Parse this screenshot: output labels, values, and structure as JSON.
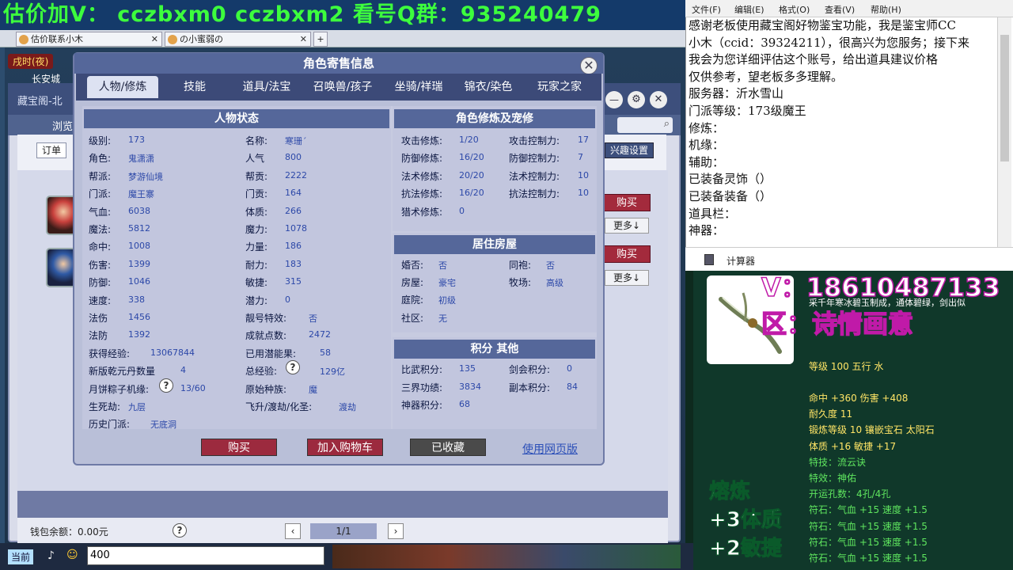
{
  "banner": {
    "text": "估价加V： cczbxm0 cczbxm2 看号Q群：935240479"
  },
  "browser_tabs": [
    {
      "label": "估价联系小木"
    },
    {
      "label": "の小蜜弱の"
    }
  ],
  "game": {
    "time": "戌时(夜)",
    "location": "长安城",
    "behind_title": "藏宝阁-北",
    "behind_nav": "浏览",
    "order_btn": "订单",
    "interest_btn": "兴趣设置",
    "buy_label": "购买",
    "more_label": "更多↓",
    "wallet": "钱包余额：0.00元",
    "page": "1/1",
    "chat_channel": "当前",
    "chat_input": "400"
  },
  "dialog": {
    "title": "角色寄售信息",
    "tabs": [
      "人物/修炼",
      "技能",
      "道具/法宝",
      "召唤兽/孩子",
      "坐骑/祥瑞",
      "锦衣/染色",
      "玩家之家"
    ],
    "status": {
      "header": "人物状态",
      "left": [
        {
          "k": "级别:",
          "v": "173"
        },
        {
          "k": "角色:",
          "v": "鬼潇潇"
        },
        {
          "k": "帮派:",
          "v": "梦游仙境"
        },
        {
          "k": "门派:",
          "v": "魔王寨"
        },
        {
          "k": "气血:",
          "v": "6038"
        },
        {
          "k": "魔法:",
          "v": "5812"
        },
        {
          "k": "命中:",
          "v": "1008"
        },
        {
          "k": "伤害:",
          "v": "1399"
        },
        {
          "k": "防御:",
          "v": "1046"
        },
        {
          "k": "速度:",
          "v": "338"
        },
        {
          "k": "法伤",
          "v": "1456"
        },
        {
          "k": "法防",
          "v": "1392"
        },
        {
          "k": "获得经验:",
          "v": "13067844"
        },
        {
          "k": "新版乾元丹数量",
          "v": "4"
        },
        {
          "k": "月饼粽子机缘:",
          "v": "13/60"
        },
        {
          "k": "生死劫:",
          "v": "九层"
        },
        {
          "k": "历史门派:",
          "v": "无底洞"
        }
      ],
      "right": [
        {
          "k": "名称:",
          "v": "寒珊´"
        },
        {
          "k": "人气",
          "v": "800"
        },
        {
          "k": "帮贡:",
          "v": "2222"
        },
        {
          "k": "门贡:",
          "v": "164"
        },
        {
          "k": "体质:",
          "v": "266"
        },
        {
          "k": "魔力:",
          "v": "1078"
        },
        {
          "k": "力量:",
          "v": "186"
        },
        {
          "k": "耐力:",
          "v": "183"
        },
        {
          "k": "敏捷:",
          "v": "315"
        },
        {
          "k": "潜力:",
          "v": "0"
        },
        {
          "k": "靓号特效:",
          "v": "否"
        },
        {
          "k": "成就点数:",
          "v": "2472"
        },
        {
          "k": "已用潜能果:",
          "v": "58"
        },
        {
          "k": "总经验:",
          "v": "129亿"
        },
        {
          "k": "原始种族:",
          "v": "魔"
        },
        {
          "k": "飞升/渡劫/化圣:",
          "v": "渡劫"
        }
      ]
    },
    "cultivation": {
      "header": "角色修炼及宠修",
      "left": [
        {
          "k": "攻击修炼:",
          "v": "1/20"
        },
        {
          "k": "防御修炼:",
          "v": "16/20"
        },
        {
          "k": "法术修炼:",
          "v": "20/20"
        },
        {
          "k": "抗法修炼:",
          "v": "16/20"
        },
        {
          "k": "猎术修炼:",
          "v": "0"
        }
      ],
      "right": [
        {
          "k": "攻击控制力:",
          "v": "17"
        },
        {
          "k": "防御控制力:",
          "v": "7"
        },
        {
          "k": "法术控制力:",
          "v": "10"
        },
        {
          "k": "抗法控制力:",
          "v": "10"
        }
      ]
    },
    "house": {
      "header": "居住房屋",
      "rows": [
        {
          "k1": "婚否:",
          "v1": "否",
          "k2": "同袍:",
          "v2": "否"
        },
        {
          "k1": "房屋:",
          "v1": "豪宅",
          "k2": "牧场:",
          "v2": "高级"
        },
        {
          "k1": "庭院:",
          "v1": "初级",
          "k2": "",
          "v2": ""
        },
        {
          "k1": "社区:",
          "v1": "无",
          "k2": "",
          "v2": ""
        }
      ]
    },
    "points": {
      "header": "积分 其他",
      "rows": [
        {
          "k1": "比武积分:",
          "v1": "135",
          "k2": "剑会积分:",
          "v2": "0"
        },
        {
          "k1": "三界功绩:",
          "v1": "3834",
          "k2": "副本积分:",
          "v2": "84"
        },
        {
          "k1": "神器积分:",
          "v1": "68",
          "k2": "",
          "v2": ""
        }
      ]
    },
    "buttons": {
      "buy": "购买",
      "cart": "加入购物车",
      "fav": "已收藏",
      "web": "使用网页版"
    }
  },
  "notepad": {
    "menu": [
      "文件(F)",
      "编辑(E)",
      "格式(O)",
      "查看(V)",
      "帮助(H)"
    ],
    "lines": [
      "感谢老板使用藏宝阁好物鉴宝功能，我是鉴宝师CC",
      "小木（ccid：39324211），很高兴为您服务；接下来",
      "我会为您详细评估这个账号，给出道具建议价格",
      "仅供参考，望老板多多理解。",
      "服务器：沂水雪山",
      "门派等级：173级魔王",
      "修炼：",
      "机缘：",
      "辅助：",
      "已装备灵饰（）",
      "已装备装备（）",
      "道具栏：",
      "神器："
    ]
  },
  "calculator": {
    "label": "计算器"
  },
  "item": {
    "desc1": "采千年寒冰碧玉制成，通体碧绿，剑出似",
    "level": "等级 100 五行 水",
    "stats": [
      "命中 +360 伤害 +408",
      "耐久度 11",
      "锻炼等级 10 镶嵌宝石 太阳石",
      "体质 +16 敏捷 +17",
      "特技：流云诀",
      "特效：神佑",
      "开运孔数：4孔/4孔",
      "符石：气血 +15 速度 +1.5",
      "符石：气血 +15 速度 +1.5",
      "符石：气血 +15 速度 +1.5",
      "符石：气血 +15 速度 +1.5"
    ],
    "overlay_v": "V：18610487133",
    "overlay_q": "区：诗情画意",
    "melt": "熔炼",
    "melt1": "+3体质",
    "melt2": "+2敏捷"
  }
}
